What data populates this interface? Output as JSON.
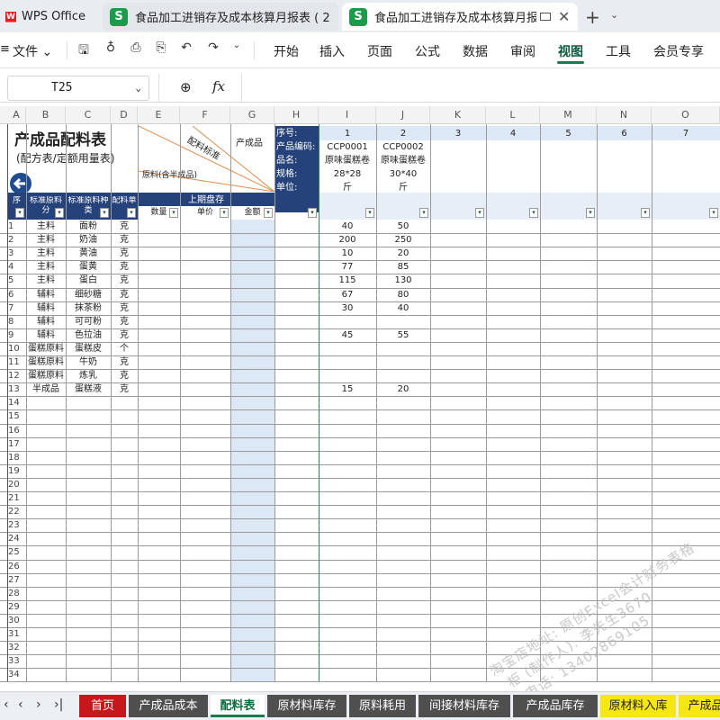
{
  "tabs": {
    "app": "WPS Office",
    "doc1": "食品加工进销存及成本核算月报表 ( 2",
    "doc2": "食品加工进销存及成本核算月报"
  },
  "menu": {
    "file": "文件",
    "items": [
      "开始",
      "插入",
      "页面",
      "公式",
      "数据",
      "审阅",
      "视图",
      "工具",
      "会员专享"
    ],
    "active": "视图"
  },
  "formula": {
    "cell_ref": "T25",
    "fx": "fx",
    "content": ""
  },
  "columns": [
    "A",
    "B",
    "C",
    "D",
    "E",
    "F",
    "G",
    "H",
    "I",
    "J",
    "K",
    "L",
    "M",
    "N",
    "O"
  ],
  "sheet": {
    "title": "产成品配料表",
    "subtitle": "(配方表/定额用量表)",
    "diag_top": "产成品",
    "diag_mid": "配料标准",
    "diag_bottom": "原料(含半成品)",
    "header_labels": {
      "seq": "序号:",
      "code": "产品编码:",
      "name": "品名:",
      "spec": "规格:",
      "unit": "单位:"
    },
    "products": [
      {
        "seq": "1",
        "code": "CCP0001",
        "name": "原味蛋糕卷",
        "spec": "28*28",
        "unit": "斤"
      },
      {
        "seq": "2",
        "code": "CCP0002",
        "name": "原味蛋糕卷",
        "spec": "30*40",
        "unit": "斤"
      },
      {
        "seq": "3"
      },
      {
        "seq": "4"
      },
      {
        "seq": "5"
      },
      {
        "seq": "6"
      },
      {
        "seq": "7"
      }
    ],
    "col_headers": {
      "seq": "序",
      "cat": "标准原料分",
      "item": "标准原料种类",
      "unit": "配料单",
      "prev_stock": "上期盘存",
      "qty": "数量",
      "price": "单价",
      "amount": "金额"
    },
    "rows": [
      {
        "n": "1",
        "cat": "主料",
        "item": "面粉",
        "unit": "克",
        "v1": "40",
        "v2": "50"
      },
      {
        "n": "2",
        "cat": "主料",
        "item": "奶油",
        "unit": "克",
        "v1": "200",
        "v2": "250"
      },
      {
        "n": "3",
        "cat": "主料",
        "item": "黄油",
        "unit": "克",
        "v1": "10",
        "v2": "20"
      },
      {
        "n": "4",
        "cat": "主料",
        "item": "蛋黄",
        "unit": "克",
        "v1": "77",
        "v2": "85"
      },
      {
        "n": "5",
        "cat": "主料",
        "item": "蛋白",
        "unit": "克",
        "v1": "115",
        "v2": "130"
      },
      {
        "n": "6",
        "cat": "辅料",
        "item": "细砂糖",
        "unit": "克",
        "v1": "67",
        "v2": "80"
      },
      {
        "n": "7",
        "cat": "辅料",
        "item": "抹茶粉",
        "unit": "克",
        "v1": "30",
        "v2": "40"
      },
      {
        "n": "8",
        "cat": "辅料",
        "item": "可可粉",
        "unit": "克",
        "v1": "",
        "v2": ""
      },
      {
        "n": "9",
        "cat": "辅料",
        "item": "色拉油",
        "unit": "克",
        "v1": "45",
        "v2": "55"
      },
      {
        "n": "10",
        "cat": "蛋糕原料",
        "item": "蛋糕皮",
        "unit": "个",
        "v1": "",
        "v2": ""
      },
      {
        "n": "11",
        "cat": "蛋糕原料",
        "item": "牛奶",
        "unit": "克",
        "v1": "",
        "v2": ""
      },
      {
        "n": "12",
        "cat": "蛋糕原料",
        "item": "炼乳",
        "unit": "克",
        "v1": "",
        "v2": ""
      },
      {
        "n": "13",
        "cat": "半成品",
        "item": "蛋糕液",
        "unit": "克",
        "v1": "15",
        "v2": "20"
      }
    ]
  },
  "sheet_tabs": [
    {
      "label": "首页",
      "bg": "#c8161d",
      "fg": "#ffffff"
    },
    {
      "label": "产成品成本",
      "bg": "#4f4f4f",
      "fg": "#ffffff"
    },
    {
      "label": "配料表",
      "bg": "#ffffff",
      "fg": "#0a6b3b",
      "active": true
    },
    {
      "label": "原材料库存",
      "bg": "#4f4f4f",
      "fg": "#ffffff"
    },
    {
      "label": "原料耗用",
      "bg": "#4f4f4f",
      "fg": "#ffffff"
    },
    {
      "label": "间接材料库存",
      "bg": "#4f4f4f",
      "fg": "#ffffff"
    },
    {
      "label": "产成品库存",
      "bg": "#4f4f4f",
      "fg": "#ffffff"
    },
    {
      "label": "原材料入库",
      "bg": "#f5e614",
      "fg": "#222222"
    },
    {
      "label": "产成品",
      "bg": "#f5e614",
      "fg": "#222222"
    }
  ],
  "watermark": {
    "line1": "淘宝店地址: 原创Excel会计财务表格",
    "line2": "柜 (制作人): 李先生3670",
    "line3": "电话: 13402869105"
  },
  "colors": {
    "navy": "#25427a",
    "accent": "#1a7a4c",
    "blue_col": "#dde8f6"
  }
}
